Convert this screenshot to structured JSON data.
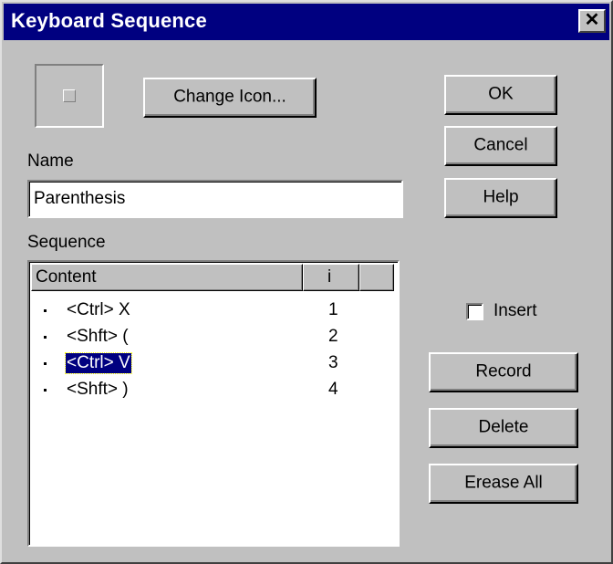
{
  "window": {
    "title": "Keyboard Sequence",
    "close_glyph": "✕"
  },
  "buttons": {
    "change_icon": "Change Icon...",
    "ok": "OK",
    "cancel": "Cancel",
    "help": "Help",
    "record": "Record",
    "delete": "Delete",
    "erase_all": "Erease All"
  },
  "name": {
    "label": "Name",
    "value": "Parenthesis"
  },
  "sequence": {
    "label": "Sequence",
    "columns": [
      "Content",
      "i"
    ],
    "rows": [
      {
        "content": "<Ctrl> X",
        "index": "1",
        "selected": false
      },
      {
        "content": "<Shft> (",
        "index": "2",
        "selected": false
      },
      {
        "content": "<Ctrl> V",
        "index": "3",
        "selected": true
      },
      {
        "content": "<Shft> )",
        "index": "4",
        "selected": false
      }
    ]
  },
  "insert": {
    "label": "Insert",
    "checked": false
  },
  "colors": {
    "titlebar": "#000080",
    "face": "#c0c0c0",
    "selection": "#000080"
  },
  "icons": {
    "preview": "blank-icon-preview"
  }
}
